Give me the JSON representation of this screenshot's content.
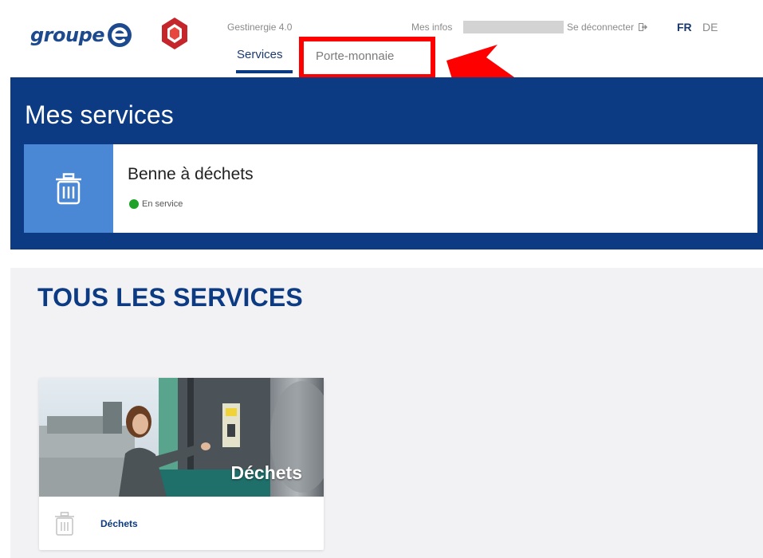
{
  "header": {
    "logo_text": "groupe",
    "app_name": "Gestinergie 4.0",
    "tabs": [
      {
        "label": "Services"
      },
      {
        "label": "Porte-monnaie"
      }
    ],
    "mes_infos": "Mes infos",
    "logout_label": "Se déconnecter",
    "languages": [
      "FR",
      "DE"
    ]
  },
  "my_services": {
    "title": "Mes services",
    "items": [
      {
        "name": "Benne à déchets",
        "status": "En service",
        "status_color": "#1fa12a",
        "icon": "trash-icon"
      }
    ]
  },
  "all_services": {
    "title": "TOUS LES SERVICES",
    "tiles": [
      {
        "image_label": "Déchets",
        "label": "Déchets",
        "icon": "trash-icon"
      }
    ]
  },
  "colors": {
    "brand_blue": "#0c3b84",
    "accent_blue": "#4a88d6",
    "highlight_red": "#ff0000"
  }
}
